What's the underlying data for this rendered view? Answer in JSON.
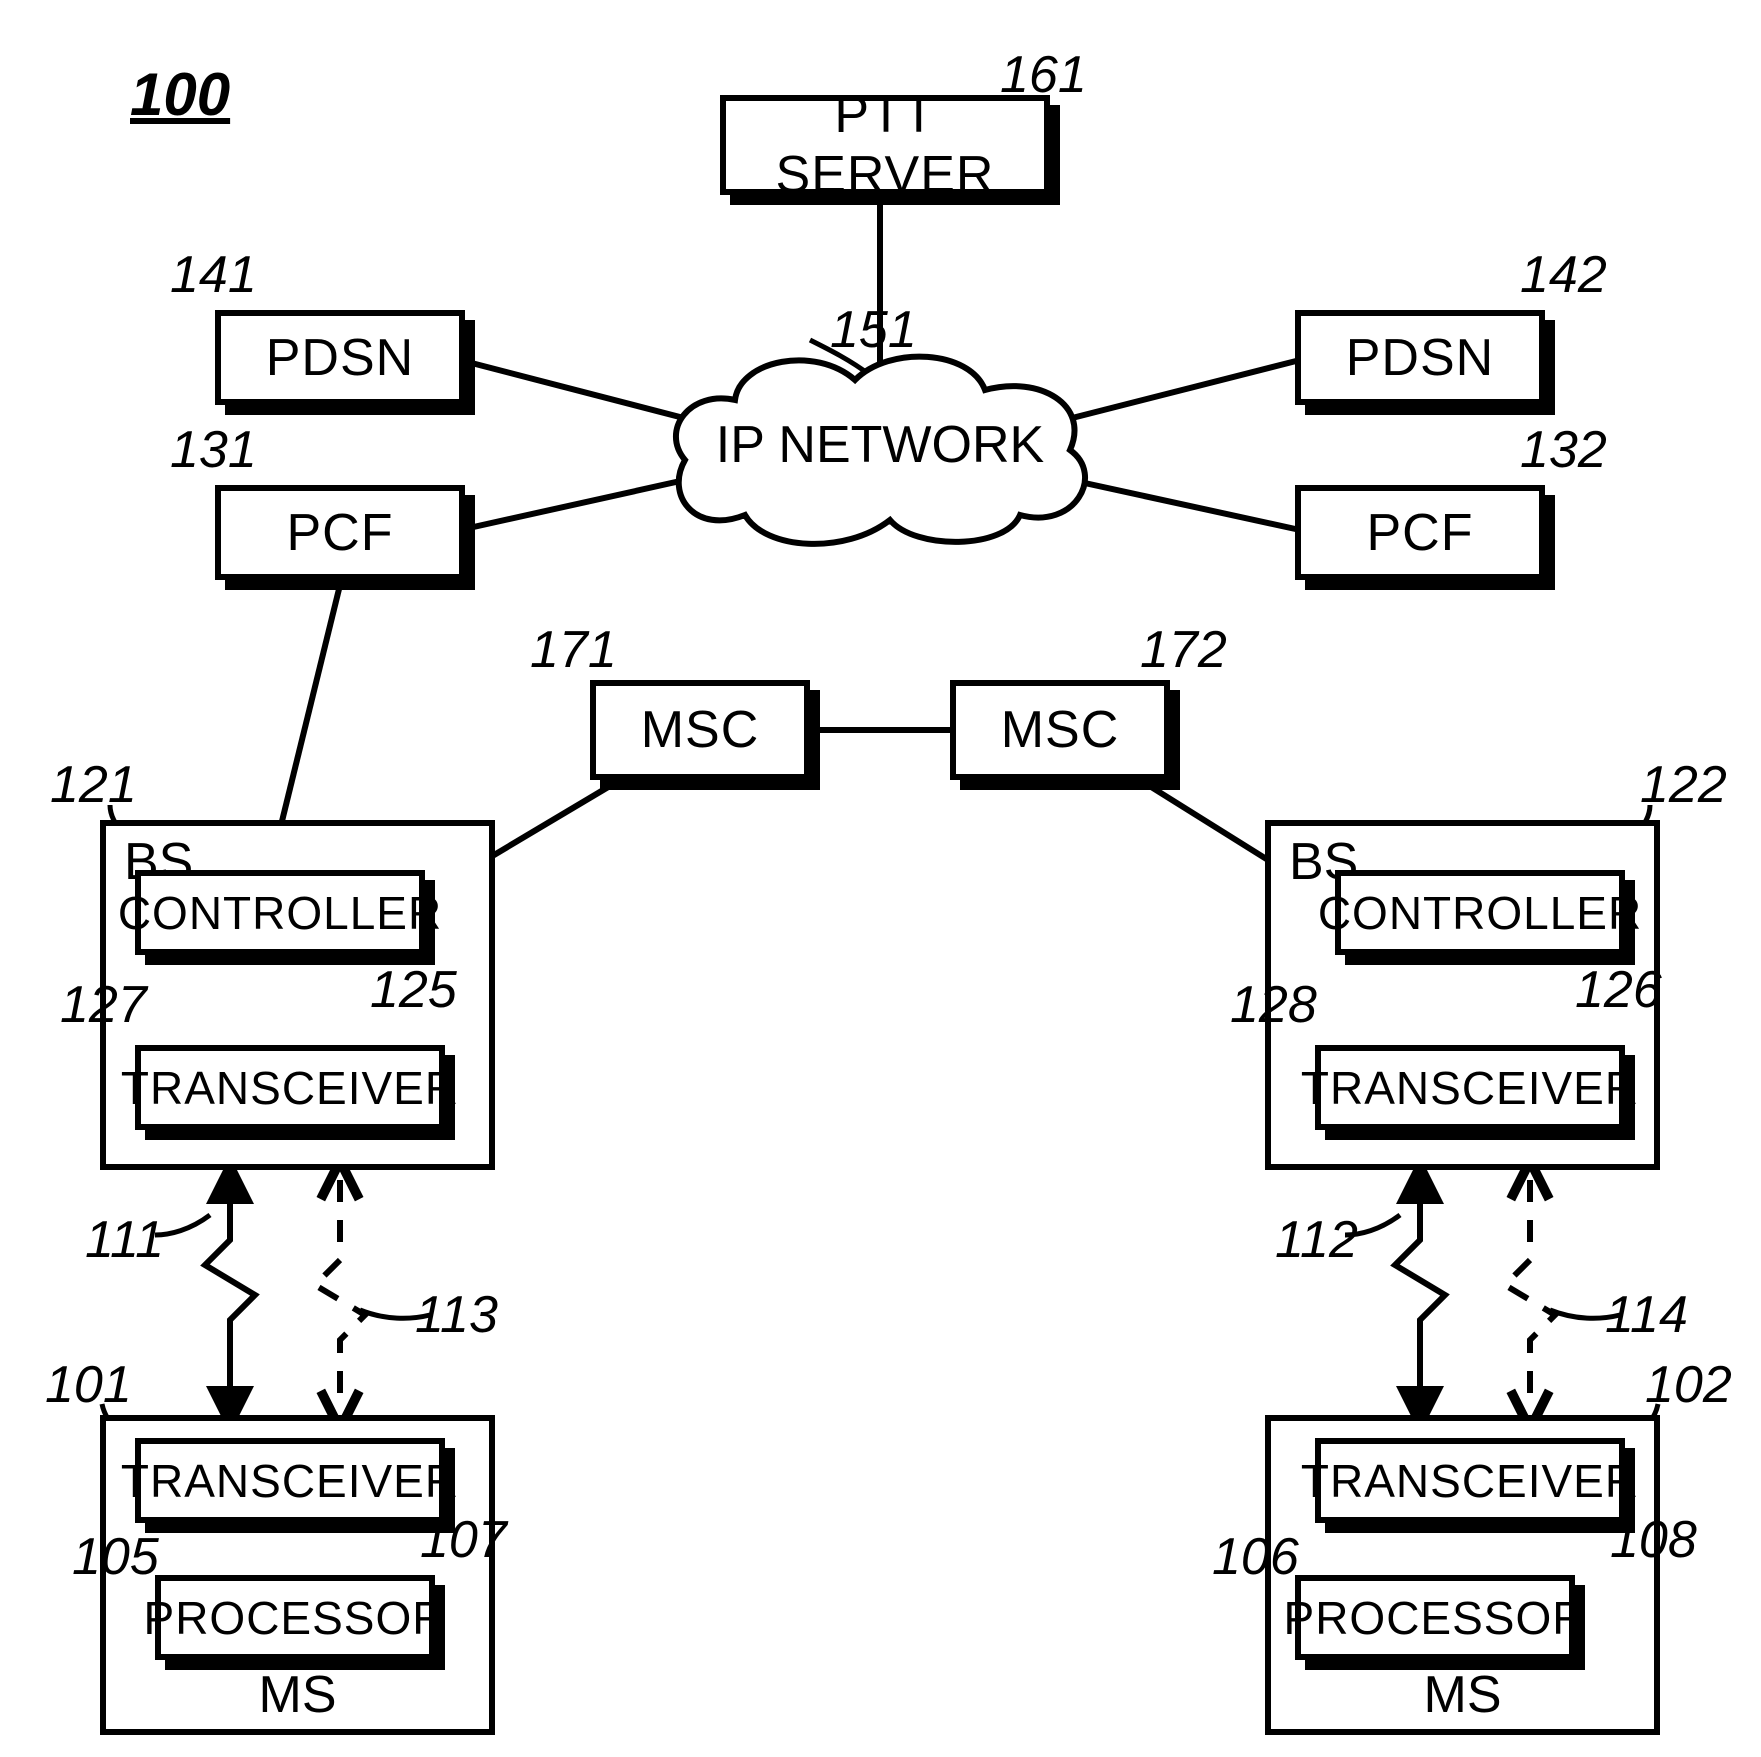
{
  "figure_ref": "100",
  "nodes": {
    "ptt": {
      "label": "PTT SERVER",
      "ref": "161"
    },
    "pdsn_l": {
      "label": "PDSN",
      "ref": "141"
    },
    "pdsn_r": {
      "label": "PDSN",
      "ref": "142"
    },
    "pcf_l": {
      "label": "PCF",
      "ref": "131"
    },
    "pcf_r": {
      "label": "PCF",
      "ref": "132"
    },
    "cloud": {
      "label": "IP NETWORK",
      "ref": "151"
    },
    "msc_l": {
      "label": "MSC",
      "ref": "171"
    },
    "msc_r": {
      "label": "MSC",
      "ref": "172"
    },
    "bs_l": {
      "label": "BS",
      "ref": "121"
    },
    "bs_r": {
      "label": "BS",
      "ref": "122"
    },
    "ctrl_l": {
      "label": "CONTROLLER",
      "ref": "125"
    },
    "ctrl_r": {
      "label": "CONTROLLER",
      "ref": "126"
    },
    "txrx_bs_l": {
      "label": "TRANSCEIVER",
      "ref": "127"
    },
    "txrx_bs_r": {
      "label": "TRANSCEIVER",
      "ref": "128"
    },
    "ms_l": {
      "label": "MS",
      "ref": "101"
    },
    "ms_r": {
      "label": "MS",
      "ref": "102"
    },
    "txrx_ms_l": {
      "label": "TRANSCEIVER",
      "ref": "107"
    },
    "txrx_ms_r": {
      "label": "TRANSCEIVER",
      "ref": "108"
    },
    "proc_l": {
      "label": "PROCESSOR",
      "ref": "105"
    },
    "proc_r": {
      "label": "PROCESSOR",
      "ref": "106"
    }
  },
  "links": {
    "wl_l_solid": {
      "ref": "111"
    },
    "wl_l_dashed": {
      "ref": "113"
    },
    "wl_r_solid": {
      "ref": "112"
    },
    "wl_r_dashed": {
      "ref": "114"
    }
  }
}
